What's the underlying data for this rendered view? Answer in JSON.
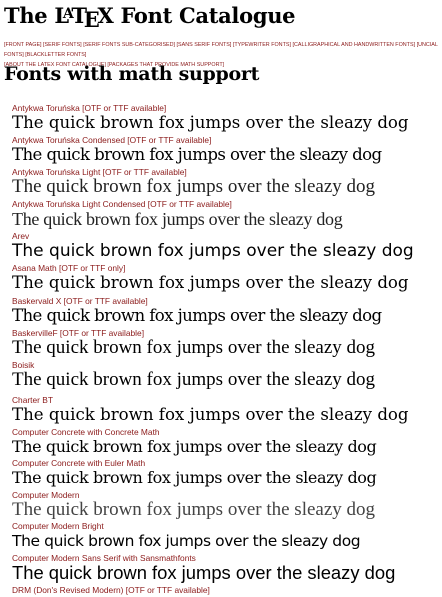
{
  "page": {
    "title_pre": "The L",
    "title_a": "A",
    "title_t": "T",
    "title_e": "E",
    "title_x_post": "X Font Catalogue",
    "section_title": "Fonts with math support"
  },
  "nav": {
    "row1": [
      "[Front page]",
      "[Serif Fonts]",
      "[Serif Fonts Sub-categorised]",
      "[Sans Serif Fonts]",
      "[Typewriter Fonts]",
      "[Calligraphical and Handwritten Fonts]",
      "[Uncial Fonts]",
      "[Blackletter Fonts]"
    ],
    "row2": [
      "[About the LaTeX Font Catalogue]",
      "[Packages that provide math support]"
    ]
  },
  "fonts": [
    {
      "name": "Antykwa Toruńska [OTF or TTF available]",
      "sample": "The quick brown fox jumps over the sleazy dog"
    },
    {
      "name": "Antykwa Toruńska Condensed [OTF or TTF available]",
      "sample": "The quick brown fox jumps over the sleazy dog"
    },
    {
      "name": "Antykwa Toruńska Light [OTF or TTF available]",
      "sample": "The quick brown fox jumps over the sleazy dog"
    },
    {
      "name": "Antykwa Toruńska Light Condensed [OTF or TTF available]",
      "sample": "The quick brown fox jumps over the sleazy dog"
    },
    {
      "name": "Arev",
      "sample": "The quick brown fox jumps over the sleazy dog"
    },
    {
      "name": "Asana Math [OTF or TTF only]",
      "sample": "The quick brown fox jumps over the sleazy dog"
    },
    {
      "name": "Baskervald X [OTF or TTF available]",
      "sample": "The quick brown fox jumps over the sleazy dog"
    },
    {
      "name": "BaskervilleF [OTF or TTF available]",
      "sample": "The quick brown fox jumps over the sleazy dog"
    },
    {
      "name": "Boisik",
      "sample": "The quick brown fox jumps over the sleazy dog"
    },
    {
      "name": "Charter BT",
      "sample": "The quick brown fox jumps over the sleazy dog"
    },
    {
      "name": "Computer Concrete with Concrete Math",
      "sample": "The quick brown fox jumps over the sleazy dog"
    },
    {
      "name": "Computer Concrete with Euler Math",
      "sample": "The quick brown fox jumps over the sleazy dog"
    },
    {
      "name": "Computer Modern",
      "sample": "The quick brown fox jumps over the sleazy dog"
    },
    {
      "name": "Computer Modern Bright",
      "sample": "The quick brown fox jumps over the sleazy dog"
    },
    {
      "name": "Computer Modern Sans Serif with Sansmathfonts",
      "sample": "The quick brown fox jumps over the sleazy dog"
    },
    {
      "name": "DRM (Don's Revised Modern) [OTF or TTF available]",
      "sample": ""
    }
  ],
  "colors": {
    "link": "#8b1a1a",
    "text": "#000000",
    "background": "#ffffff"
  }
}
